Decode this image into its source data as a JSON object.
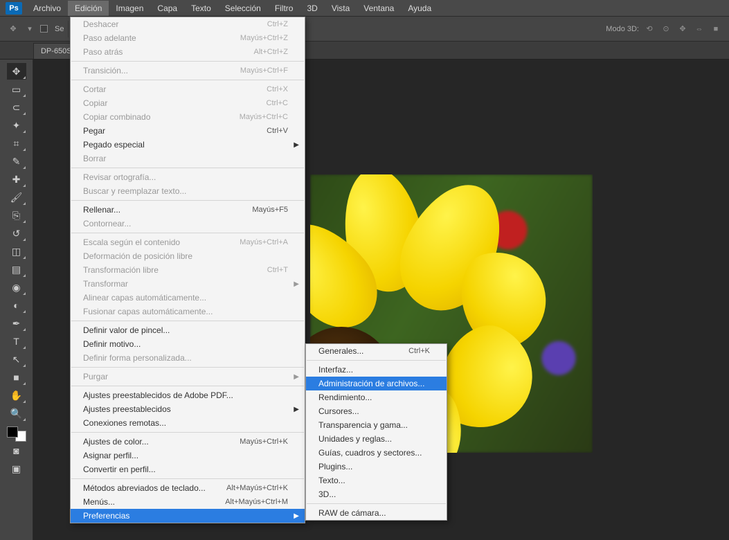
{
  "app": {
    "logo": "Ps"
  },
  "menubar": [
    "Archivo",
    "Edición",
    "Imagen",
    "Capa",
    "Texto",
    "Selección",
    "Filtro",
    "3D",
    "Vista",
    "Ventana",
    "Ayuda"
  ],
  "menubar_active_index": 1,
  "options": {
    "sel_label": "Se",
    "mode3d_label": "Modo 3D:"
  },
  "tab": {
    "label": "DP-650S-"
  },
  "edit_menu": [
    {
      "type": "item",
      "label": "Deshacer",
      "shortcut": "Ctrl+Z",
      "disabled": true
    },
    {
      "type": "item",
      "label": "Paso adelante",
      "shortcut": "Mayús+Ctrl+Z",
      "disabled": true
    },
    {
      "type": "item",
      "label": "Paso atrás",
      "shortcut": "Alt+Ctrl+Z",
      "disabled": true
    },
    {
      "type": "sep"
    },
    {
      "type": "item",
      "label": "Transición...",
      "shortcut": "Mayús+Ctrl+F",
      "disabled": true
    },
    {
      "type": "sep"
    },
    {
      "type": "item",
      "label": "Cortar",
      "shortcut": "Ctrl+X",
      "disabled": true
    },
    {
      "type": "item",
      "label": "Copiar",
      "shortcut": "Ctrl+C",
      "disabled": true
    },
    {
      "type": "item",
      "label": "Copiar combinado",
      "shortcut": "Mayús+Ctrl+C",
      "disabled": true
    },
    {
      "type": "item",
      "label": "Pegar",
      "shortcut": "Ctrl+V"
    },
    {
      "type": "item",
      "label": "Pegado especial",
      "arrow": true
    },
    {
      "type": "item",
      "label": "Borrar",
      "disabled": true
    },
    {
      "type": "sep"
    },
    {
      "type": "item",
      "label": "Revisar ortografía...",
      "disabled": true
    },
    {
      "type": "item",
      "label": "Buscar y reemplazar texto...",
      "disabled": true
    },
    {
      "type": "sep"
    },
    {
      "type": "item",
      "label": "Rellenar...",
      "shortcut": "Mayús+F5"
    },
    {
      "type": "item",
      "label": "Contornear...",
      "disabled": true
    },
    {
      "type": "sep"
    },
    {
      "type": "item",
      "label": "Escala según el contenido",
      "shortcut": "Mayús+Ctrl+A",
      "disabled": true
    },
    {
      "type": "item",
      "label": "Deformación de posición libre",
      "disabled": true
    },
    {
      "type": "item",
      "label": "Transformación libre",
      "shortcut": "Ctrl+T",
      "disabled": true
    },
    {
      "type": "item",
      "label": "Transformar",
      "arrow": true,
      "disabled": true
    },
    {
      "type": "item",
      "label": "Alinear capas automáticamente...",
      "disabled": true
    },
    {
      "type": "item",
      "label": "Fusionar capas automáticamente...",
      "disabled": true
    },
    {
      "type": "sep"
    },
    {
      "type": "item",
      "label": "Definir valor de pincel..."
    },
    {
      "type": "item",
      "label": "Definir motivo..."
    },
    {
      "type": "item",
      "label": "Definir forma personalizada...",
      "disabled": true
    },
    {
      "type": "sep"
    },
    {
      "type": "item",
      "label": "Purgar",
      "arrow": true,
      "disabled": true
    },
    {
      "type": "sep"
    },
    {
      "type": "item",
      "label": "Ajustes preestablecidos de Adobe PDF..."
    },
    {
      "type": "item",
      "label": "Ajustes preestablecidos",
      "arrow": true
    },
    {
      "type": "item",
      "label": "Conexiones remotas..."
    },
    {
      "type": "sep"
    },
    {
      "type": "item",
      "label": "Ajustes de color...",
      "shortcut": "Mayús+Ctrl+K"
    },
    {
      "type": "item",
      "label": "Asignar perfil..."
    },
    {
      "type": "item",
      "label": "Convertir en perfil..."
    },
    {
      "type": "sep"
    },
    {
      "type": "item",
      "label": "Métodos abreviados de teclado...",
      "shortcut": "Alt+Mayús+Ctrl+K"
    },
    {
      "type": "item",
      "label": "Menús...",
      "shortcut": "Alt+Mayús+Ctrl+M"
    },
    {
      "type": "item",
      "label": "Preferencias",
      "arrow": true,
      "selected": true
    }
  ],
  "prefs_submenu": [
    {
      "type": "item",
      "label": "Generales...",
      "shortcut": "Ctrl+K"
    },
    {
      "type": "sep"
    },
    {
      "type": "item",
      "label": "Interfaz..."
    },
    {
      "type": "item",
      "label": "Administración de archivos...",
      "selected": true
    },
    {
      "type": "item",
      "label": "Rendimiento..."
    },
    {
      "type": "item",
      "label": "Cursores..."
    },
    {
      "type": "item",
      "label": "Transparencia y gama..."
    },
    {
      "type": "item",
      "label": "Unidades y reglas..."
    },
    {
      "type": "item",
      "label": "Guías, cuadros y sectores..."
    },
    {
      "type": "item",
      "label": "Plugins..."
    },
    {
      "type": "item",
      "label": "Texto..."
    },
    {
      "type": "item",
      "label": "3D..."
    },
    {
      "type": "sep"
    },
    {
      "type": "item",
      "label": "RAW de cámara..."
    }
  ],
  "tools": [
    "move",
    "marquee",
    "lasso",
    "wand",
    "crop",
    "eyedropper",
    "heal",
    "brush",
    "clone",
    "history",
    "eraser",
    "gradient",
    "blur",
    "dodge",
    "pen",
    "type",
    "path",
    "shape",
    "hand",
    "zoom"
  ]
}
